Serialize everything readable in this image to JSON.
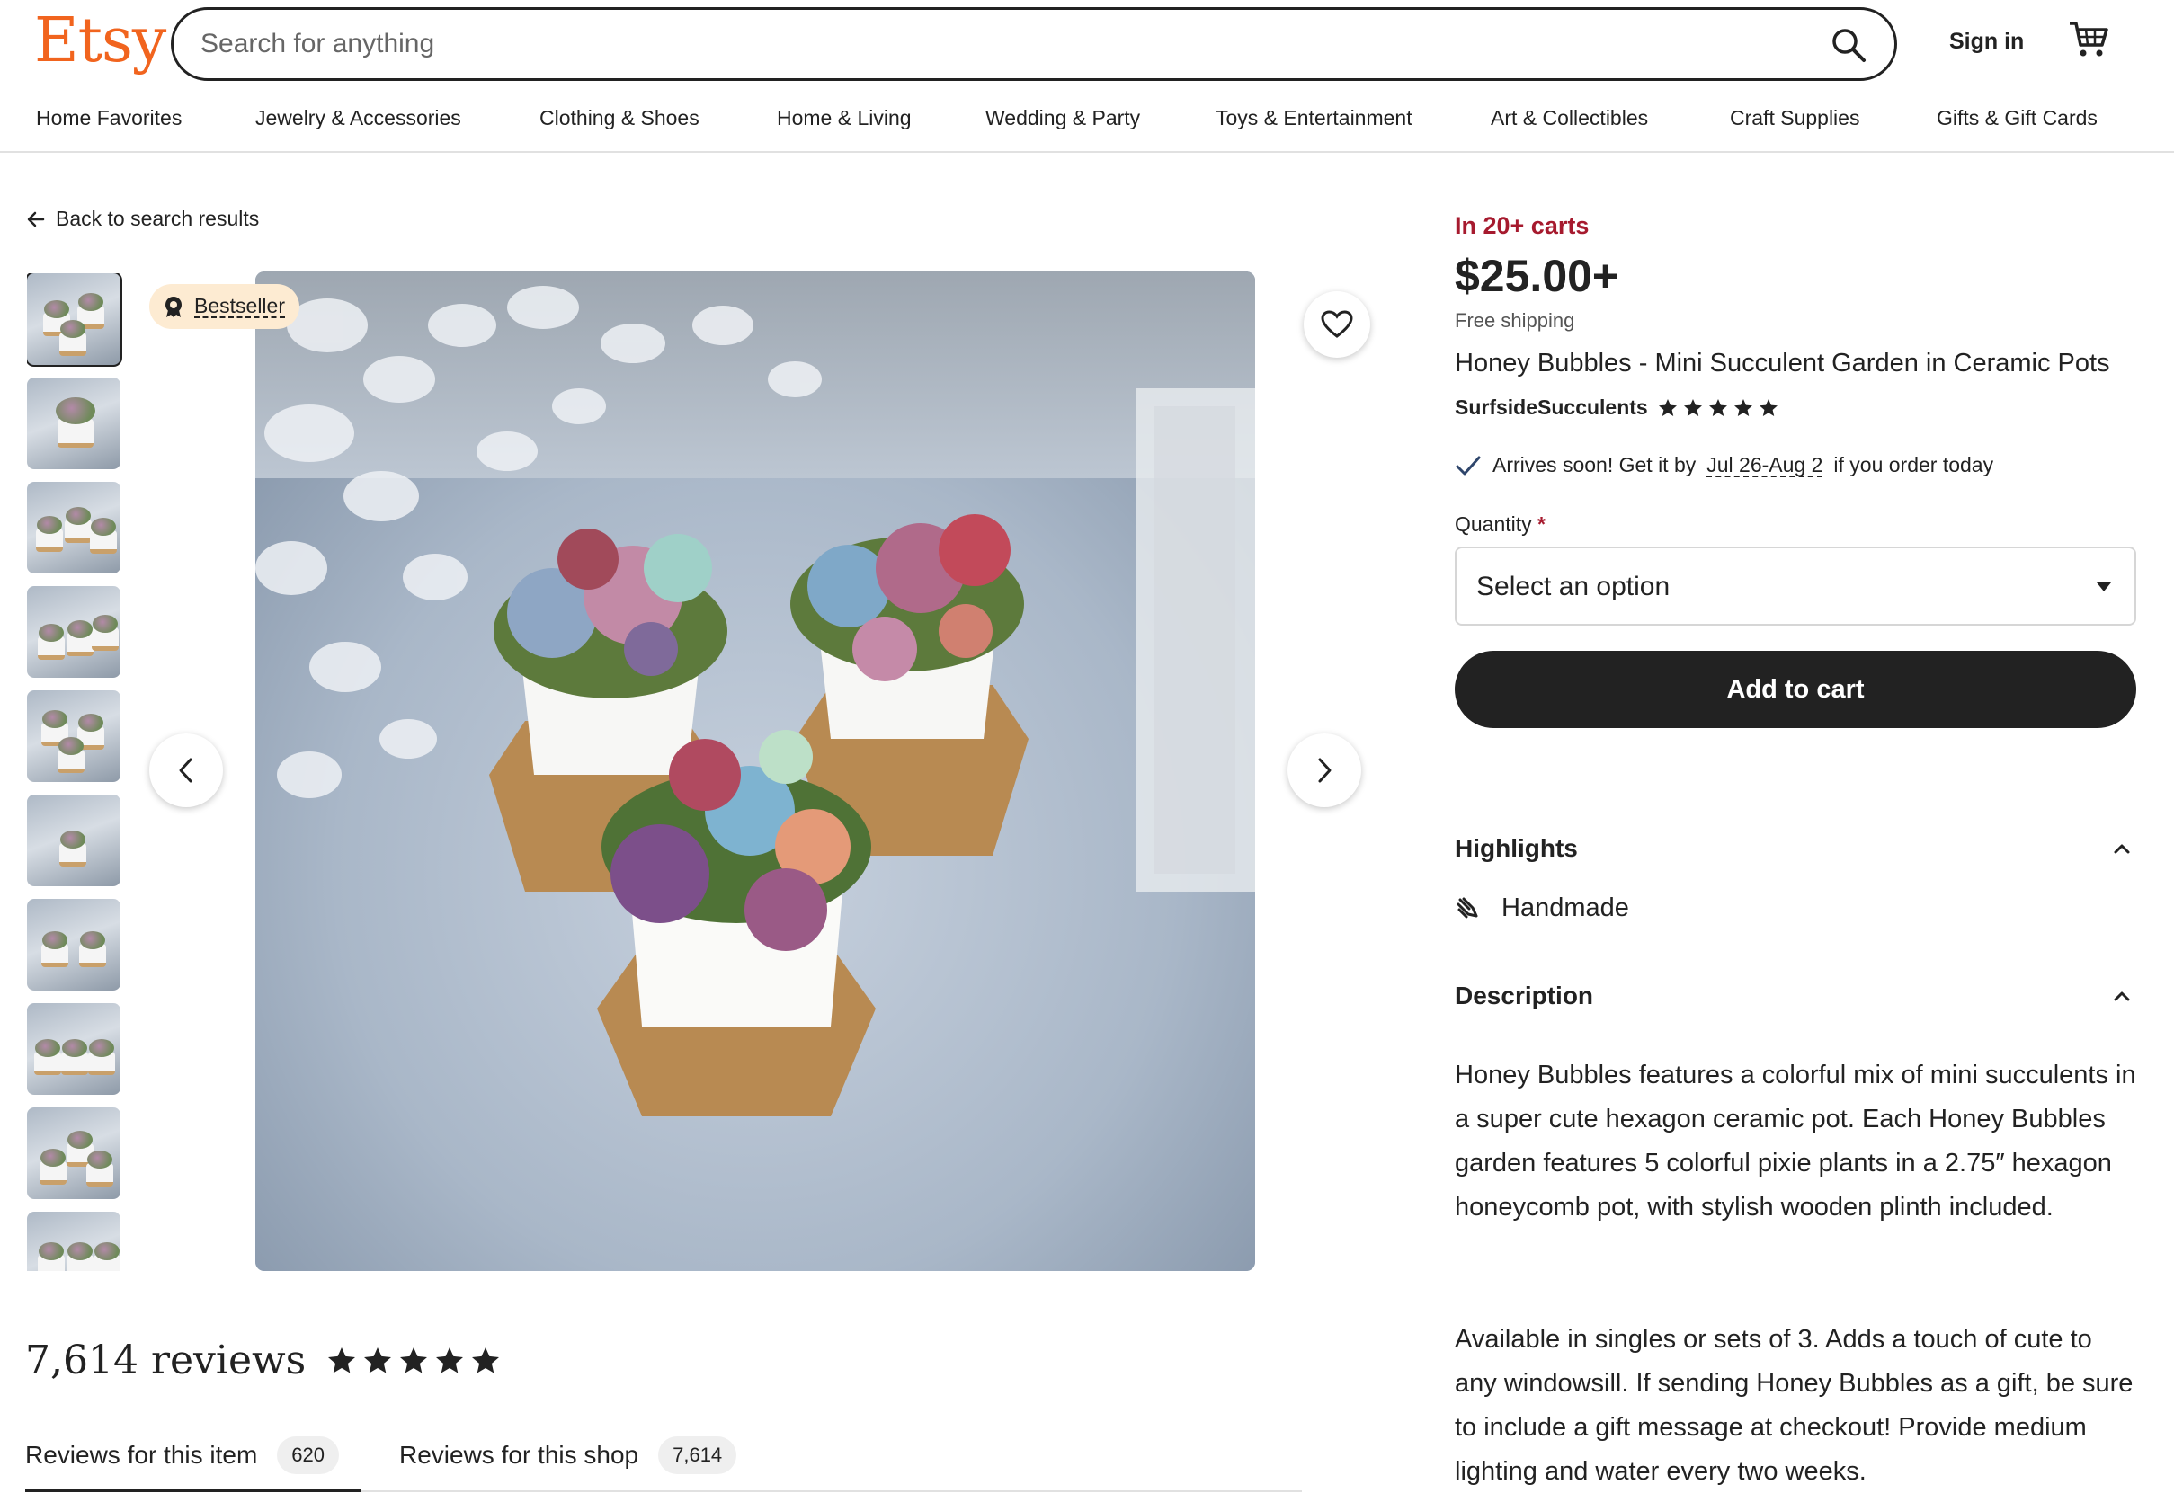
{
  "header": {
    "logo": "Etsy",
    "search_placeholder": "Search for anything",
    "sign_in": "Sign in"
  },
  "nav": [
    "Home Favorites",
    "Jewelry & Accessories",
    "Clothing & Shoes",
    "Home & Living",
    "Wedding & Party",
    "Toys & Entertainment",
    "Art & Collectibles",
    "Craft Supplies",
    "Gifts & Gift Cards"
  ],
  "gallery": {
    "back_label": "Back to search results",
    "badge": "Bestseller",
    "thumbnail_count": 10
  },
  "reviews": {
    "count_label": "7,614 reviews",
    "rating": 5,
    "tabs": [
      {
        "label": "Reviews for this item",
        "count": "620"
      },
      {
        "label": "Reviews for this shop",
        "count": "7,614"
      }
    ]
  },
  "listing": {
    "carts_notice": "In 20+ carts",
    "price": "$25.00+",
    "shipping": "Free shipping",
    "title": "Honey Bubbles - Mini Succulent Garden in Ceramic Pots",
    "shop_name": "SurfsideSucculents",
    "shop_rating": 5,
    "arrival_prefix": "Arrives soon! Get it by",
    "arrival_dates": "Jul 26-Aug 2",
    "arrival_suffix": "if you order today",
    "quantity_label": "Quantity",
    "quantity_required": "*",
    "quantity_value": "Select an option",
    "add_to_cart": "Add to cart"
  },
  "highlights": {
    "heading": "Highlights",
    "items": [
      "Handmade"
    ]
  },
  "description": {
    "heading": "Description",
    "paragraph1": "Honey Bubbles features a colorful mix of mini succulents in a super cute hexagon ceramic pot. Each Honey Bubbles garden features 5 colorful pixie plants in a 2.75″ hexagon honeycomb pot, with stylish wooden plinth included.",
    "paragraph2": "Available in singles or sets of 3. Adds a touch of cute to any windowsill. If sending Honey Bubbles as a gift, be sure to include a gift message at checkout! Provide medium lighting and water every two weeks."
  },
  "colors": {
    "brand": "#f1641e",
    "carts_notice": "#a61a2e",
    "badge_bg": "#fdebd2",
    "button_bg": "#222222"
  },
  "icons": [
    "search-icon",
    "cart-icon",
    "arrow-left-icon",
    "bestseller-award-icon",
    "heart-icon",
    "chevron-left-icon",
    "chevron-right-icon",
    "star-icon",
    "checkmark-icon",
    "dropdown-caret-icon",
    "chevron-up-icon",
    "handmade-hand-icon"
  ]
}
